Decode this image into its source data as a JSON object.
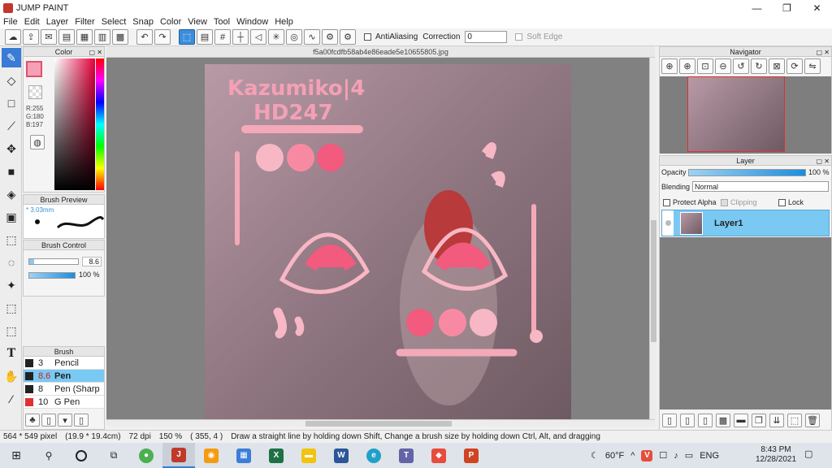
{
  "window": {
    "title": "JUMP PAINT",
    "controls": [
      "—",
      "❐",
      "✕"
    ]
  },
  "menu": [
    "File",
    "Edit",
    "Layer",
    "Filter",
    "Select",
    "Snap",
    "Color",
    "View",
    "Tool",
    "Window",
    "Help"
  ],
  "toolbar": {
    "antialiasing_label": "AntiAliasing",
    "correction_label": "Correction",
    "correction_value": "0",
    "soft_edge_label": "Soft Edge"
  },
  "document": {
    "filename": "f5a00fcdfb58ab4e86eade5e10655805.jpg"
  },
  "color_panel": {
    "title": "Color",
    "r": "R:255",
    "g": "G:180",
    "b": "B:197",
    "current_color": "#f5a0b5"
  },
  "brush_preview": {
    "title": "Brush Preview",
    "size": "3.03mm"
  },
  "brush_control": {
    "title": "Brush Control",
    "size_value": "8.6",
    "opacity_value": "100 %"
  },
  "brush_list": {
    "title": "Brush",
    "items": [
      {
        "size": "3",
        "name": "Pencil",
        "selected": false,
        "color": "#222222"
      },
      {
        "size": "8.6",
        "name": "Pen",
        "selected": true,
        "color": "#222222"
      },
      {
        "size": "8",
        "name": "Pen (Sharp",
        "selected": false,
        "color": "#222222"
      },
      {
        "size": "10",
        "name": "G Pen",
        "selected": false,
        "color": "#e03030"
      }
    ]
  },
  "artwork": {
    "line1": "Kazumiko|4",
    "line2": "HD247"
  },
  "navigator": {
    "title": "Navigator"
  },
  "layer_panel": {
    "title": "Layer",
    "opacity_label": "Opacity",
    "opacity_value": "100 %",
    "blending_label": "Blending",
    "blending_value": "Normal",
    "protect_alpha": "Protect Alpha",
    "clipping": "Clipping",
    "lock": "Lock",
    "layers": [
      {
        "name": "Layer1"
      }
    ]
  },
  "status": {
    "size": "564 * 549 pixel",
    "cm": "(19.9 * 19.4cm)",
    "dpi": "72 dpi",
    "zoom": "150 %",
    "coords": "( 355, 4 )",
    "hint": "Draw a straight line by holding down Shift, Change a brush size by holding down Ctrl, Alt, and dragging"
  },
  "taskbar": {
    "weather": "60°F",
    "lang": "ENG",
    "time": "8:43 PM",
    "date": "12/28/2021"
  }
}
